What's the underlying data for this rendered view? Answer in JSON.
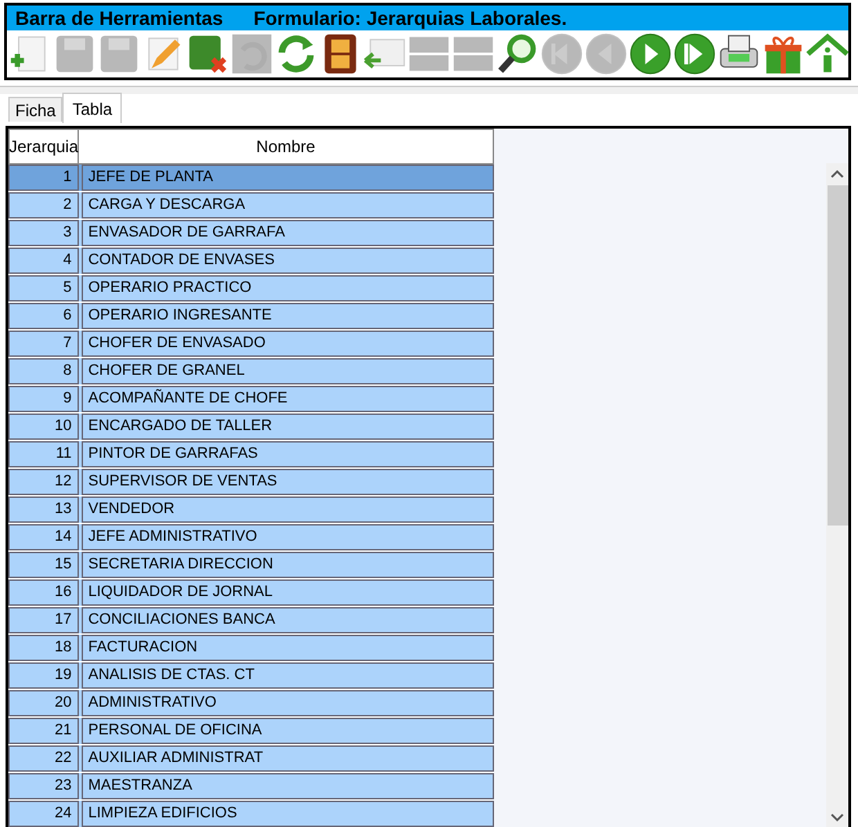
{
  "title_bar": {
    "left": "Barra de Herramientas",
    "right": "Formulario: Jerarquias Laborales."
  },
  "toolbar": [
    {
      "kind": "new",
      "disabled": false
    },
    {
      "kind": "save",
      "disabled": true
    },
    {
      "kind": "save",
      "disabled": true
    },
    {
      "kind": "edit",
      "disabled": false
    },
    {
      "kind": "cancel",
      "disabled": false
    },
    {
      "kind": "undo",
      "disabled": true
    },
    {
      "kind": "refresh",
      "disabled": false
    },
    {
      "kind": "film",
      "disabled": false
    },
    {
      "kind": "mail",
      "disabled": false
    },
    {
      "kind": "bar",
      "disabled": true
    },
    {
      "kind": "bar",
      "disabled": true
    },
    {
      "kind": "search",
      "disabled": false
    },
    {
      "kind": "first",
      "disabled": true
    },
    {
      "kind": "prev",
      "disabled": true
    },
    {
      "kind": "play",
      "disabled": false
    },
    {
      "kind": "next",
      "disabled": false
    },
    {
      "kind": "print",
      "disabled": false
    },
    {
      "kind": "gift",
      "disabled": false
    },
    {
      "kind": "home",
      "disabled": false
    }
  ],
  "tabs": [
    {
      "label": "Ficha",
      "selected": false
    },
    {
      "label": "Tabla",
      "selected": true
    }
  ],
  "table": {
    "columns": [
      "Jerarquia",
      "Nombre"
    ],
    "rows": [
      {
        "cells": [
          "1",
          "JEFE DE PLANTA"
        ],
        "selected": true
      },
      {
        "cells": [
          "2",
          "CARGA Y DESCARGA"
        ],
        "selected": false
      },
      {
        "cells": [
          "3",
          "ENVASADOR DE GARRAFA"
        ],
        "selected": false
      },
      {
        "cells": [
          "4",
          "CONTADOR DE ENVASES"
        ],
        "selected": false
      },
      {
        "cells": [
          "5",
          "OPERARIO PRACTICO"
        ],
        "selected": false
      },
      {
        "cells": [
          "6",
          "OPERARIO INGRESANTE"
        ],
        "selected": false
      },
      {
        "cells": [
          "7",
          "CHOFER DE ENVASADO"
        ],
        "selected": false
      },
      {
        "cells": [
          "8",
          "CHOFER DE GRANEL"
        ],
        "selected": false
      },
      {
        "cells": [
          "9",
          "ACOMPAÑANTE DE CHOFE"
        ],
        "selected": false
      },
      {
        "cells": [
          "10",
          "ENCARGADO DE TALLER"
        ],
        "selected": false
      },
      {
        "cells": [
          "11",
          "PINTOR DE GARRAFAS"
        ],
        "selected": false
      },
      {
        "cells": [
          "12",
          "SUPERVISOR DE VENTAS"
        ],
        "selected": false
      },
      {
        "cells": [
          "13",
          "VENDEDOR"
        ],
        "selected": false
      },
      {
        "cells": [
          "14",
          "JEFE ADMINISTRATIVO"
        ],
        "selected": false
      },
      {
        "cells": [
          "15",
          "SECRETARIA DIRECCION"
        ],
        "selected": false
      },
      {
        "cells": [
          "16",
          "LIQUIDADOR DE JORNAL"
        ],
        "selected": false
      },
      {
        "cells": [
          "17",
          "CONCILIACIONES BANCA"
        ],
        "selected": false
      },
      {
        "cells": [
          "18",
          "FACTURACION"
        ],
        "selected": false
      },
      {
        "cells": [
          "19",
          "ANALISIS DE CTAS. CT"
        ],
        "selected": false
      },
      {
        "cells": [
          "20",
          "ADMINISTRATIVO"
        ],
        "selected": false
      },
      {
        "cells": [
          "21",
          "PERSONAL DE OFICINA"
        ],
        "selected": false
      },
      {
        "cells": [
          "22",
          "AUXILIAR ADMINISTRAT"
        ],
        "selected": false
      },
      {
        "cells": [
          "23",
          "MAESTRANZA"
        ],
        "selected": false
      },
      {
        "cells": [
          "24",
          "LIMPIEZA EDIFICIOS"
        ],
        "selected": false
      }
    ]
  }
}
